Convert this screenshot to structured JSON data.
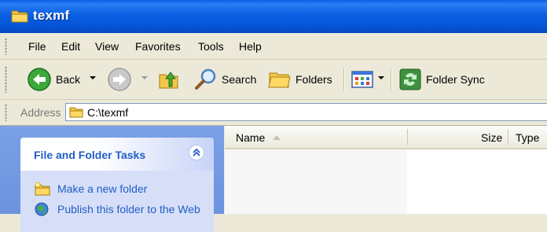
{
  "window": {
    "title": "texmf"
  },
  "menu": [
    "File",
    "Edit",
    "View",
    "Favorites",
    "Tools",
    "Help"
  ],
  "toolbar": {
    "back_label": "Back",
    "search_label": "Search",
    "folders_label": "Folders",
    "folder_sync_label": "Folder Sync"
  },
  "address": {
    "label": "Address",
    "value": "C:\\texmf"
  },
  "task_pane": {
    "title": "File and Folder Tasks",
    "tasks": [
      "Make a new folder",
      "Publish this folder to the Web"
    ]
  },
  "file_list": {
    "columns": [
      "Name",
      "Size",
      "Type"
    ]
  },
  "colors": {
    "titlebar": "#0a5fe3",
    "task_link": "#215dc6",
    "task_pane_bg": "#7aa1e6"
  }
}
